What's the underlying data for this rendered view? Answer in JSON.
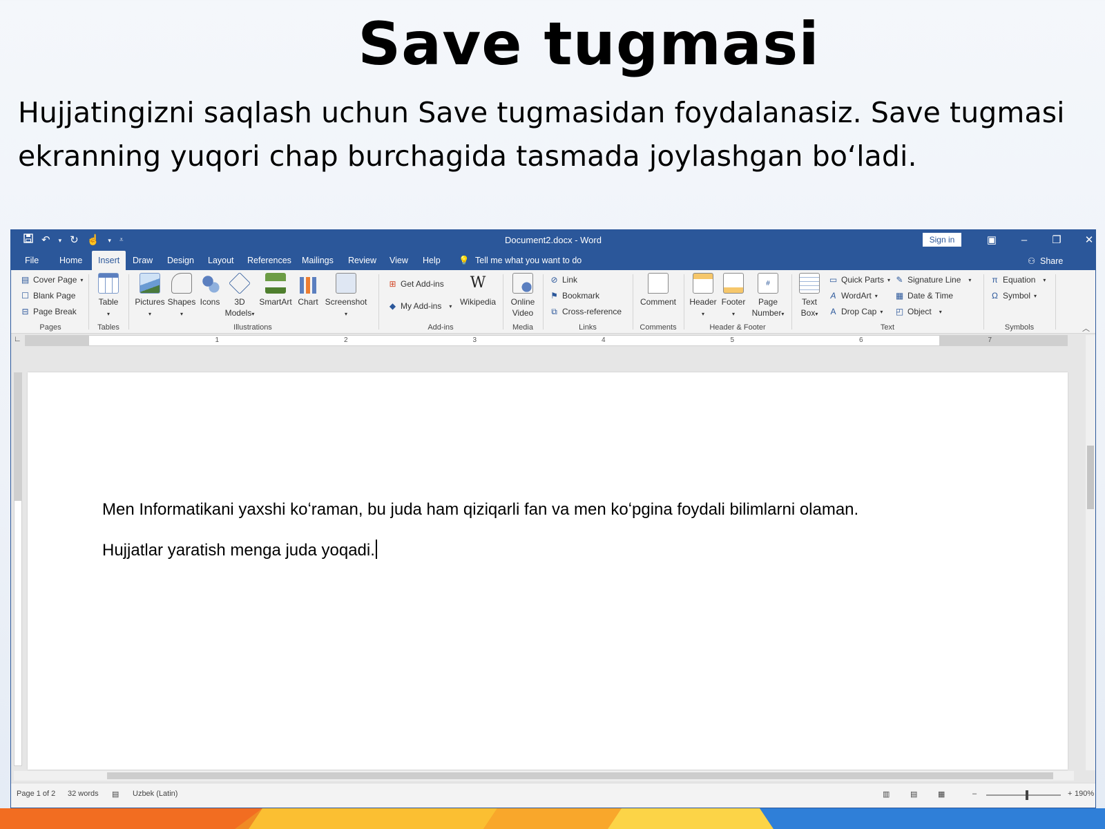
{
  "slide": {
    "title": "Save tugmasi",
    "body": "Hujjatingizni saqlash uchun Save tugmasidan foydalanasiz. Save tugmasi ekranning yuqori chap burchagida tasmada joylashgan bo‘ladi."
  },
  "word": {
    "title_bar": {
      "document_title": "Document2.docx  -  Word",
      "sign_in": "Sign in"
    },
    "tabs": [
      "File",
      "Home",
      "Insert",
      "Draw",
      "Design",
      "Layout",
      "References",
      "Mailings",
      "Review",
      "View",
      "Help"
    ],
    "active_tab": "Insert",
    "tell_me": "Tell me what you want to do",
    "share": "Share",
    "ribbon": {
      "pages": {
        "label": "Pages",
        "cover_page": "Cover Page",
        "blank_page": "Blank Page",
        "page_break": "Page Break"
      },
      "tables": {
        "label": "Tables",
        "table": "Table"
      },
      "illustrations": {
        "label": "Illustrations",
        "pictures": "Pictures",
        "shapes": "Shapes",
        "icons": "Icons",
        "models_1": "3D",
        "models_2": "Models",
        "smartart": "SmartArt",
        "chart": "Chart",
        "screenshot": "Screenshot"
      },
      "addins": {
        "label": "Add-ins",
        "get_addins": "Get Add-ins",
        "my_addins": "My Add-ins",
        "wikipedia": "Wikipedia"
      },
      "media": {
        "label": "Media",
        "online_1": "Online",
        "online_2": "Video"
      },
      "links": {
        "label": "Links",
        "link": "Link",
        "bookmark": "Bookmark",
        "cross_reference": "Cross-reference"
      },
      "comments": {
        "label": "Comments",
        "comment": "Comment"
      },
      "header_footer": {
        "label": "Header & Footer",
        "header": "Header",
        "footer": "Footer",
        "page_number_1": "Page",
        "page_number_2": "Number"
      },
      "text": {
        "label": "Text",
        "text_box_1": "Text",
        "text_box_2": "Box",
        "quick_parts": "Quick Parts",
        "wordart": "WordArt",
        "drop_cap": "Drop Cap",
        "signature_line": "Signature Line",
        "date_time": "Date & Time",
        "object": "Object"
      },
      "symbols": {
        "label": "Symbols",
        "equation": "Equation",
        "symbol": "Symbol"
      }
    },
    "ruler_numbers": [
      "1",
      "2",
      "3",
      "4",
      "5",
      "6",
      "7"
    ],
    "document_lines": [
      "Men Informatikani yaxshi koʻraman, bu juda ham qiziqarli fan va men koʻpgina foydali bilimlarni olaman.",
      "Hujjatlar yaratish menga juda yoqadi."
    ],
    "status_bar": {
      "page": "Page 1 of 2",
      "words": "32 words",
      "language": "Uzbek (Latin)",
      "zoom": "190%"
    }
  },
  "colors": {
    "word_blue": "#2b579a"
  },
  "icons": [
    "save-icon",
    "undo-icon",
    "redo-icon",
    "touch-mode-icon",
    "customize-qat-icon",
    "ribbon-display-icon",
    "minimize-icon",
    "restore-icon",
    "close-icon",
    "lightbulb-icon",
    "share-icon"
  ]
}
